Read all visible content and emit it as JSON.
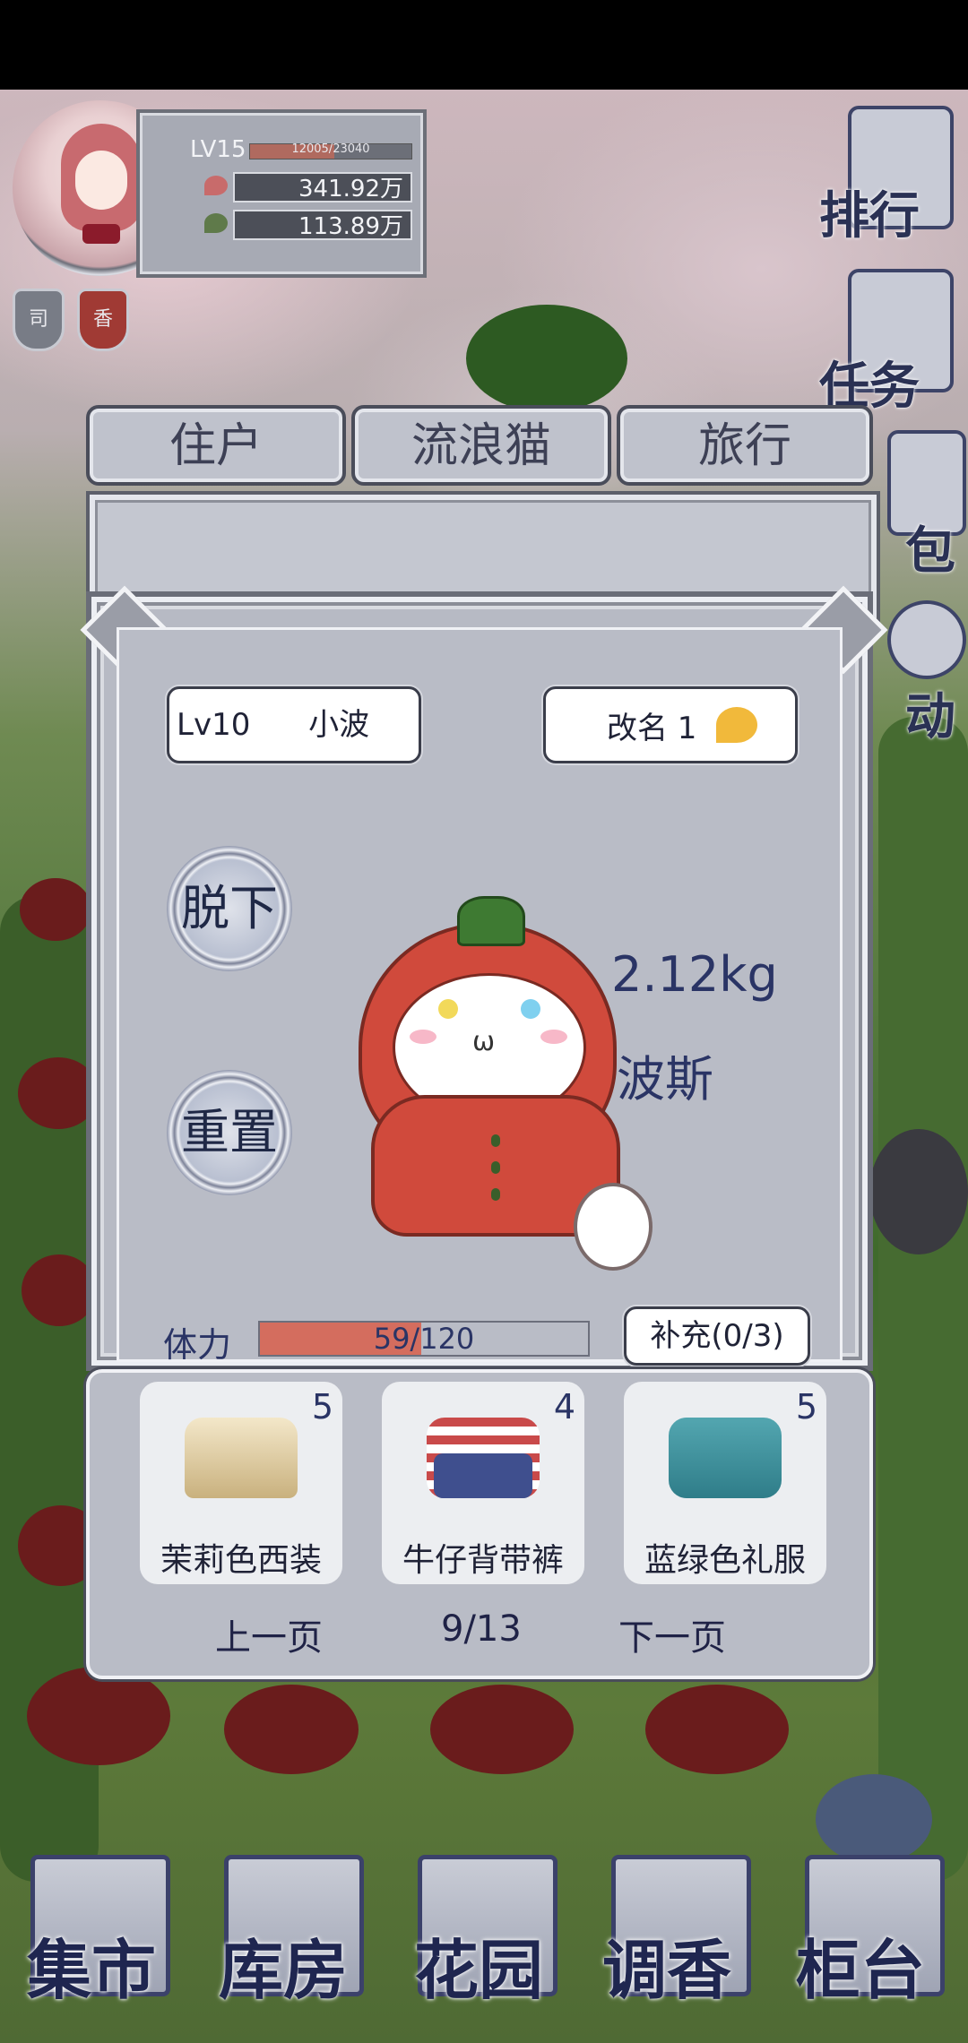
{
  "profile": {
    "level": "LV15",
    "exp_text": "12005/23040",
    "exp_progress": 0.52,
    "currency_petals": "341.92万",
    "currency_leaves": "113.89万",
    "seal_left": "司",
    "seal_right": "香"
  },
  "side_menu": [
    "排行",
    "任务",
    "包",
    "动"
  ],
  "tabs": [
    "住户",
    "流浪猫",
    "旅行"
  ],
  "cat": {
    "level_name": "Lv10      小波",
    "rename_label": "改名 1",
    "undress_label": "脱下",
    "reset_label": "重置",
    "weight": "2.12kg",
    "breed": "波斯",
    "stamina_label": "体力",
    "stamina_text": "59/120",
    "stamina_value": 59,
    "stamina_max": 120,
    "refill_label": "补充(0/3)"
  },
  "outfits": [
    {
      "name": "茉莉色西装",
      "count": "5"
    },
    {
      "name": "牛仔背带裤",
      "count": "4"
    },
    {
      "name": "蓝绿色礼服",
      "count": "5"
    }
  ],
  "pager": {
    "prev": "上一页",
    "page": "9/13",
    "next": "下一页"
  },
  "bottom_nav": [
    "集市",
    "库房",
    "花园",
    "调香",
    "柜台"
  ],
  "colors": {
    "stamina_fill": "#d46d5e",
    "text_navy": "#2a3465",
    "panel_gray": "#b9bcc6"
  }
}
